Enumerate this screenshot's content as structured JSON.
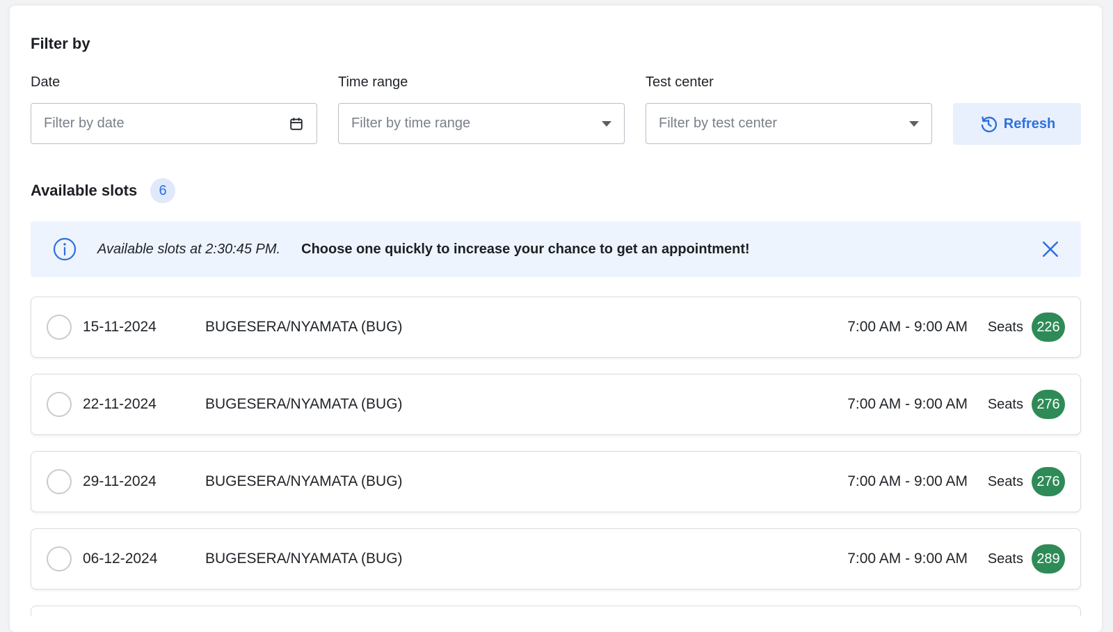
{
  "filter": {
    "title": "Filter by",
    "date_label": "Date",
    "date_placeholder": "Filter by date",
    "time_label": "Time range",
    "time_placeholder": "Filter by time range",
    "center_label": "Test center",
    "center_placeholder": "Filter by test center",
    "refresh_label": "Refresh"
  },
  "slots": {
    "title": "Available slots",
    "count": "6",
    "seats_label": "Seats",
    "items": [
      {
        "date": "15-11-2024",
        "center": "BUGESERA/NYAMATA (BUG)",
        "time": "7:00 AM - 9:00 AM",
        "seats": "226"
      },
      {
        "date": "22-11-2024",
        "center": "BUGESERA/NYAMATA (BUG)",
        "time": "7:00 AM - 9:00 AM",
        "seats": "276"
      },
      {
        "date": "29-11-2024",
        "center": "BUGESERA/NYAMATA (BUG)",
        "time": "7:00 AM - 9:00 AM",
        "seats": "276"
      },
      {
        "date": "06-12-2024",
        "center": "BUGESERA/NYAMATA (BUG)",
        "time": "7:00 AM - 9:00 AM",
        "seats": "289"
      }
    ]
  },
  "alert": {
    "time_text": "Available slots at 2:30:45 PM.",
    "message": "Choose one quickly to increase your chance to get an appointment!"
  },
  "colors": {
    "accent": "#2f6fe0",
    "seat_badge": "#2e8b57",
    "alert_bg": "#eef4fe"
  },
  "icons": {
    "calendar": "calendar-icon",
    "dropdown": "chevron-down-icon",
    "refresh": "refresh-icon",
    "info": "info-icon",
    "close": "close-icon"
  }
}
